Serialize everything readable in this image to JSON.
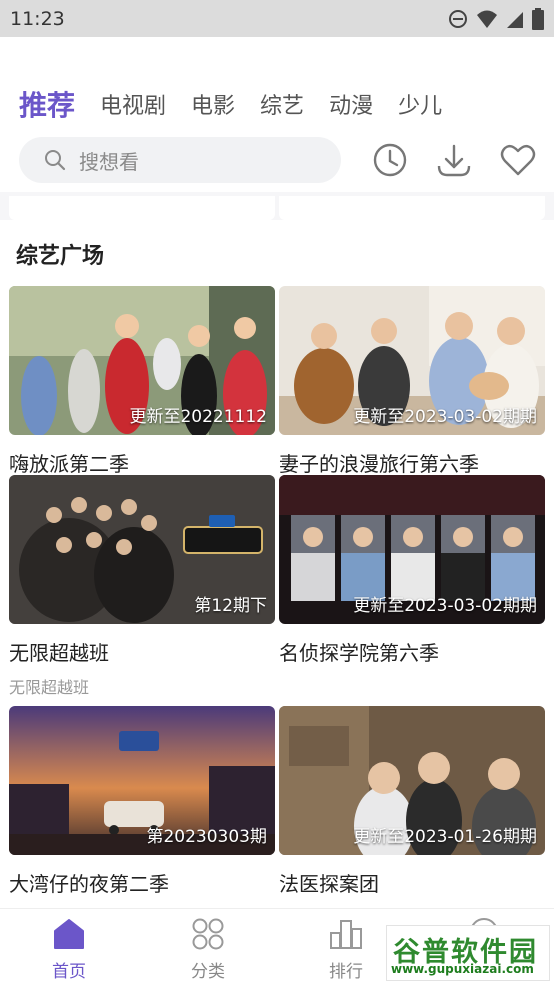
{
  "status_bar": {
    "time": "11:23",
    "icons": [
      "do-not-disturb-icon",
      "wifi-icon",
      "cell-signal-icon",
      "battery-icon"
    ]
  },
  "category_tabs": [
    {
      "label": "推荐",
      "active": true
    },
    {
      "label": "电视剧",
      "active": false
    },
    {
      "label": "电影",
      "active": false
    },
    {
      "label": "综艺",
      "active": false
    },
    {
      "label": "动漫",
      "active": false
    },
    {
      "label": "少儿",
      "active": false
    }
  ],
  "search": {
    "placeholder": "搜想看"
  },
  "toolbar_icons": [
    "history-icon",
    "download-icon",
    "favorite-icon"
  ],
  "section": {
    "title": "综艺广场"
  },
  "cards": [
    {
      "title": "嗨放派第二季",
      "badge": "更新至20221112",
      "subtitle": ""
    },
    {
      "title": "妻子的浪漫旅行第六季",
      "badge": "更新至2023-03-02期期",
      "subtitle": ""
    },
    {
      "title": "无限超越班",
      "badge": "第12期下",
      "subtitle": "无限超越班"
    },
    {
      "title": "名侦探学院第六季",
      "badge": "更新至2023-03-02期期",
      "subtitle": ""
    },
    {
      "title": "大湾仔的夜第二季",
      "badge": "第20230303期",
      "subtitle": ""
    },
    {
      "title": "法医探案团",
      "badge": "更新至2023-01-26期期",
      "subtitle": ""
    }
  ],
  "bottom_nav": [
    {
      "label": "首页",
      "icon": "home-icon",
      "active": true
    },
    {
      "label": "分类",
      "icon": "category-grid-icon",
      "active": false
    },
    {
      "label": "排行",
      "icon": "ranking-icon",
      "active": false
    },
    {
      "label": "",
      "icon": "profile-icon",
      "active": false
    }
  ],
  "watermark": {
    "text": "谷普软件园",
    "url": "www.gupuxiazai.com"
  },
  "colors": {
    "accent": "#6b56c9",
    "status_bar": "#dcdcdc",
    "search_bg": "#f1f2f4"
  }
}
